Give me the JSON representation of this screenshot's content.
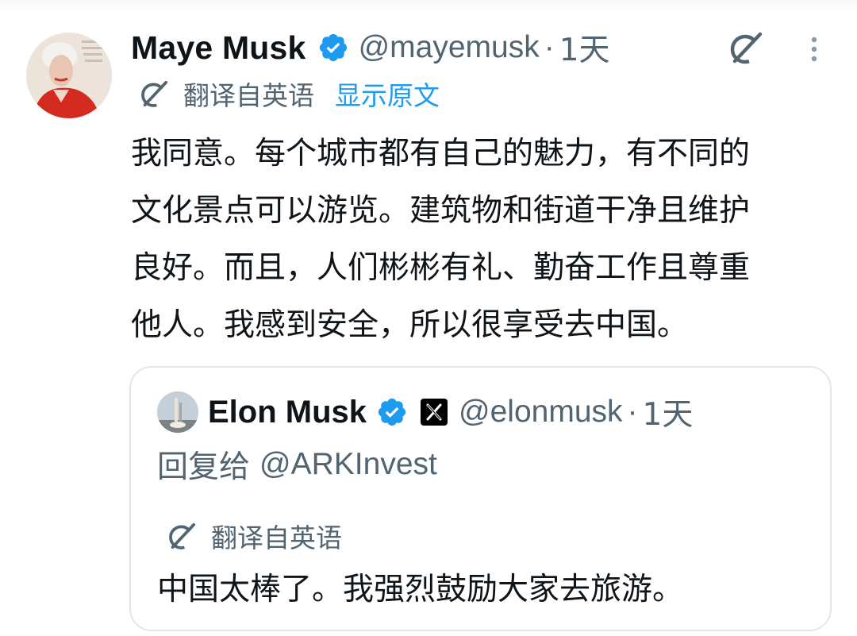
{
  "tweet": {
    "author": {
      "display_name": "Maye Musk",
      "handle": "@mayemusk",
      "separator": "·",
      "time": "1天",
      "verified_icon": "verified-badge-icon",
      "avatar_icon": "avatar"
    },
    "actions": {
      "grok_icon": "grok-icon",
      "more_icon": "more-options-icon"
    },
    "translation": {
      "label": "翻译自英语",
      "show_original": "显示原文",
      "icon": "translate-icon"
    },
    "body_lines": [
      "我同意。每个城市都有自己的魅力，有不同的",
      "文化景点可以游览。建筑物和街道干净且维护",
      "良好。而且，人们彬彬有礼、勤奋工作且尊重",
      "他人。我感到安全，所以很享受去中国。"
    ],
    "quote": {
      "author": {
        "display_name": "Elon Musk",
        "handle": "@elonmusk",
        "separator": "·",
        "time": "1天",
        "verified_icon": "verified-badge-icon",
        "affiliation_icon": "x-logo-icon"
      },
      "reply_prefix": "回复给",
      "reply_mention": "@ARKInvest",
      "translation_label": "翻译自英语",
      "body": "中国太棒了。我强烈鼓励大家去旅游。"
    }
  },
  "colors": {
    "text_primary": "#0f1419",
    "text_secondary": "#536471",
    "link_blue": "#1d9bf0",
    "verified_blue": "#1d9bf0",
    "card_border": "#e3e7eb"
  }
}
